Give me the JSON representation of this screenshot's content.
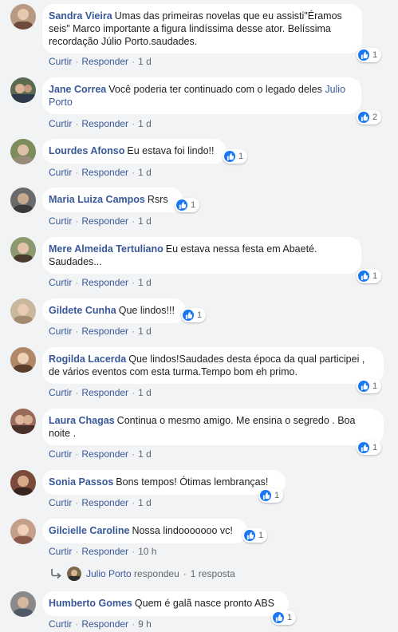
{
  "actions": {
    "like": "Curtir",
    "reply": "Responder",
    "dot": "·"
  },
  "comments": [
    {
      "author": "Sandra Vieira",
      "text": "Umas das primeiras novelas que eu assisti\"Éramos seis\" Marco importante a figura lindíssima desse ator. Belíssima recordação Júlio Porto.saudades.",
      "time": "1 d",
      "likes": "1"
    },
    {
      "author": "Jane Correa",
      "text": "Você poderia ter continuado com o legado deles",
      "mention": "Julio Porto",
      "time": "1 d",
      "likes": "2"
    },
    {
      "author": "Lourdes Afonso",
      "text": "Eu estava foi lindo!!",
      "time": "1 d",
      "likes": "1"
    },
    {
      "author": "Maria Luiza Campos",
      "text": "Rsrs",
      "time": "1 d",
      "likes": "1"
    },
    {
      "author": "Mere Almeida Tertuliano",
      "text": "Eu estava nessa festa em Abaeté. Saudades...",
      "time": "1 d",
      "likes": "1"
    },
    {
      "author": "Gildete Cunha",
      "text": "Que lindos!!!",
      "time": "1 d",
      "likes": "1"
    },
    {
      "author": "Rogilda Lacerda",
      "text": "Que lindos!Saudades desta época da qual participei , de vários eventos com esta turma.Tempo bom eh primo.",
      "time": "1 d",
      "likes": "1"
    },
    {
      "author": "Laura Chagas",
      "text": "Continua o mesmo amigo. Me ensina o segredo . Boa noite .",
      "time": "1 d",
      "likes": "1"
    },
    {
      "author": "Sonia Passos",
      "text": "Bons tempos! Ótimas lembranças!",
      "time": "1 d",
      "likes": "1"
    },
    {
      "author": "Gilcielle Caroline",
      "text": "Nossa lindooooooo vc!",
      "time": "10 h",
      "likes": "1"
    },
    {
      "author": "Humberto Gomes",
      "text": "Quem é galã nasce pronto ABS",
      "time": "9 h",
      "likes": "1"
    }
  ],
  "reply_summary": {
    "name": "Julio Porto",
    "text": "respondeu",
    "count": "1 resposta"
  },
  "colors": {
    "link": "#385898",
    "like_blue": "#1877f2",
    "background": "#f2f3f5"
  }
}
